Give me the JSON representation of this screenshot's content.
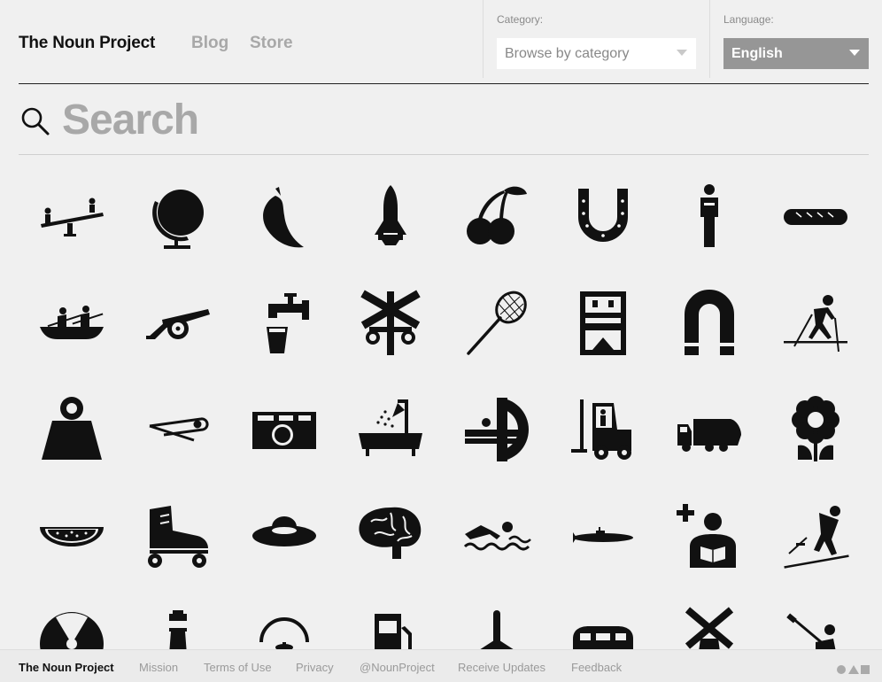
{
  "header": {
    "logo": "The Noun Project",
    "nav": {
      "blog": "Blog",
      "store": "Store"
    },
    "category": {
      "label": "Category:",
      "value": "Browse by category"
    },
    "language": {
      "label": "Language:",
      "value": "English"
    }
  },
  "search": {
    "placeholder": "Search"
  },
  "icons": [
    [
      "seesaw-icon",
      "globe-icon",
      "chili-pepper-icon",
      "space-shuttle-icon",
      "cherries-icon",
      "horseshoe-icon",
      "person-icon",
      "baguette-icon"
    ],
    [
      "canoe-icon",
      "cannon-icon",
      "water-tap-icon",
      "railroad-crossing-icon",
      "badminton-racket-icon",
      "robot-icon",
      "magnet-icon",
      "cross-country-skier-icon"
    ],
    [
      "weight-icon",
      "safety-pin-icon",
      "camera-icon",
      "bathtub-shower-icon",
      "mri-scanner-icon",
      "forklift-icon",
      "garbage-truck-icon",
      "flower-icon"
    ],
    [
      "watermelon-icon",
      "roller-skate-icon",
      "ufo-icon",
      "brain-icon",
      "swimmer-icon",
      "submarine-icon",
      "pharmacist-icon",
      "ski-jumper-icon"
    ],
    [
      "radiation-icon",
      "lighthouse-icon",
      "kettle-icon",
      "fuel-pump-icon",
      "airplane-icon",
      "trailer-icon",
      "windmill-icon",
      "kayaker-icon"
    ]
  ],
  "footer": {
    "brand": "The Noun Project",
    "links": [
      "Mission",
      "Terms of Use",
      "Privacy",
      "@NounProject",
      "Receive Updates",
      "Feedback"
    ],
    "shapes_icon": "circle-triangle-square-icon"
  }
}
